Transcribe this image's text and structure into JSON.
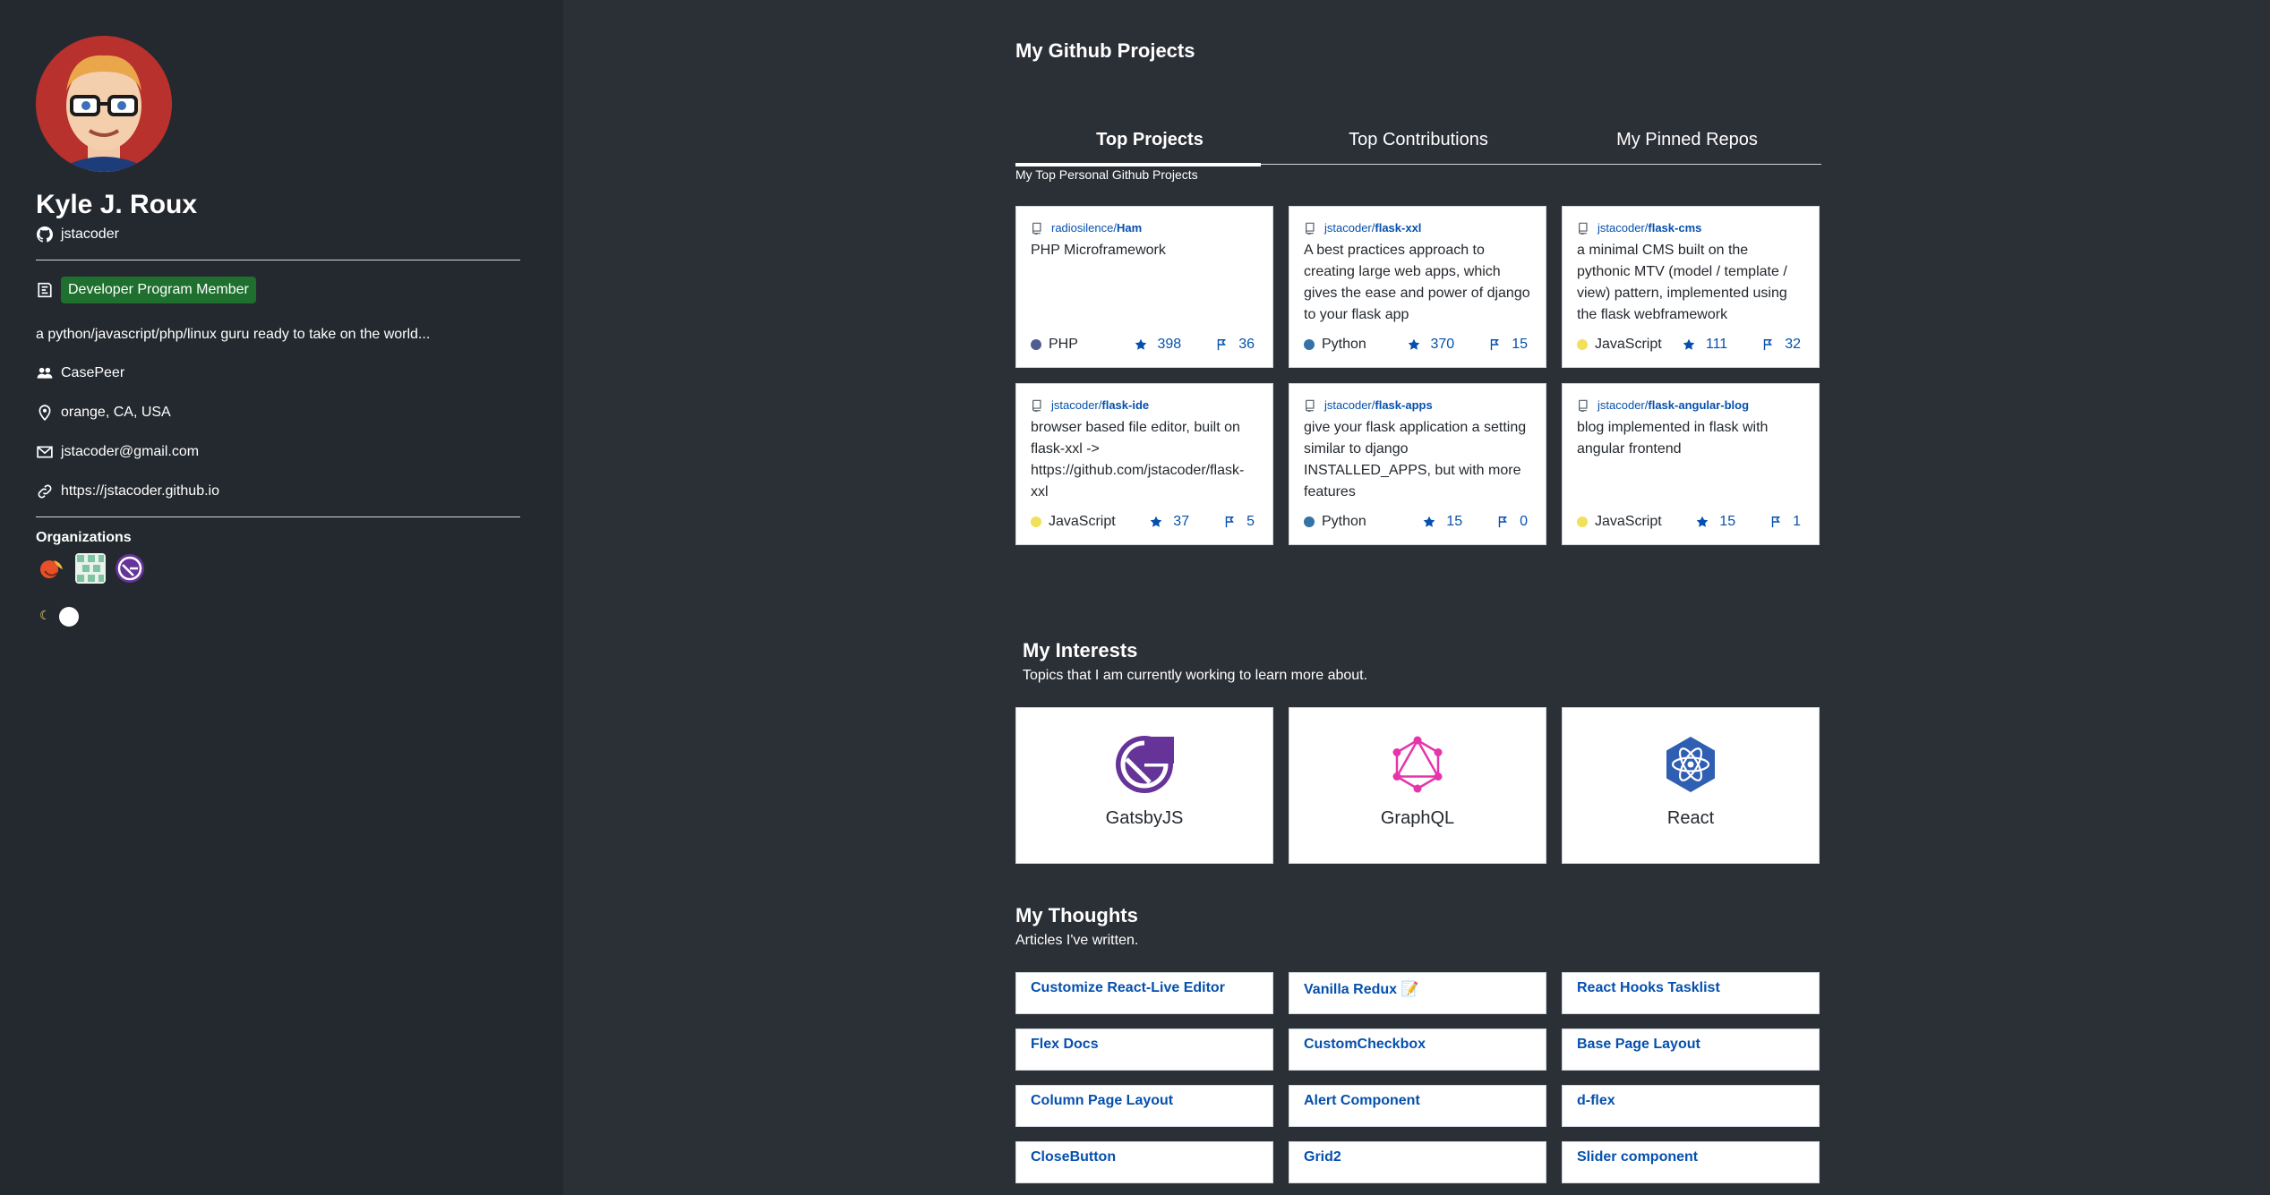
{
  "profile": {
    "name": "Kyle J. Roux",
    "handle": "jstacoder",
    "badge": "Developer Program Member",
    "bio": "a python/javascript/php/linux guru ready to take on the world...",
    "company": "CasePeer",
    "location": "orange, CA, USA",
    "email": "jstacoder@gmail.com",
    "website": "https://jstacoder.github.io",
    "organizations_label": "Organizations"
  },
  "main": {
    "title": "My Github Projects",
    "tabs": [
      {
        "label": "Top Projects",
        "active": true
      },
      {
        "label": "Top Contributions",
        "active": false
      },
      {
        "label": "My Pinned Repos",
        "active": false
      }
    ],
    "tab_description": "My Top Personal Github Projects",
    "projects": [
      {
        "owner": "radiosilence/",
        "name": "Ham",
        "description": "PHP Microframework",
        "language": "PHP",
        "lang_color": "#4f5d95",
        "stars": "398",
        "forks": "36"
      },
      {
        "owner": "jstacoder/",
        "name": "flask-xxl",
        "description": "A best practices approach to creating large web apps, which gives the ease and power of django to your flask app",
        "language": "Python",
        "lang_color": "#3572a5",
        "stars": "370",
        "forks": "15"
      },
      {
        "owner": "jstacoder/",
        "name": "flask-cms",
        "description": "a minimal CMS built on the pythonic MTV (model / template / view) pattern, implemented using the flask webframework",
        "language": "JavaScript",
        "lang_color": "#f1e05a",
        "stars": "111",
        "forks": "32"
      },
      {
        "owner": "jstacoder/",
        "name": "flask-ide",
        "description": "browser based file editor, built on flask-xxl -> https://github.com/jstacoder/flask-xxl",
        "language": "JavaScript",
        "lang_color": "#f1e05a",
        "stars": "37",
        "forks": "5"
      },
      {
        "owner": "jstacoder/",
        "name": "flask-apps",
        "description": "give your flask application a setting similar to django INSTALLED_APPS, but with more features",
        "language": "Python",
        "lang_color": "#3572a5",
        "stars": "15",
        "forks": "0"
      },
      {
        "owner": "jstacoder/",
        "name": "flask-angular-blog",
        "description": "blog implemented in flask with angular frontend",
        "language": "JavaScript",
        "lang_color": "#f1e05a",
        "stars": "15",
        "forks": "1"
      }
    ],
    "interests": {
      "title": "My Interests",
      "subtitle": "Topics that I am currently working to learn more about.",
      "items": [
        {
          "label": "GatsbyJS",
          "icon": "gatsby-icon"
        },
        {
          "label": "GraphQL",
          "icon": "graphql-icon"
        },
        {
          "label": "React",
          "icon": "react-icon"
        }
      ]
    },
    "thoughts": {
      "title": "My Thoughts",
      "subtitle": "Articles I've written.",
      "items": [
        "Customize React-Live Editor",
        "Vanilla Redux 📝",
        "React Hooks Tasklist",
        "Flex Docs",
        "CustomCheckbox",
        "Base Page Layout",
        "Column Page Layout",
        "Alert Component",
        "d-flex",
        "CloseButton",
        "Grid2",
        "Slider component"
      ]
    }
  },
  "colors": {
    "sidebar_bg": "#24292f",
    "page_bg": "#2b2f36",
    "badge_green": "#1f6f2f",
    "link_blue": "#0550ae"
  }
}
